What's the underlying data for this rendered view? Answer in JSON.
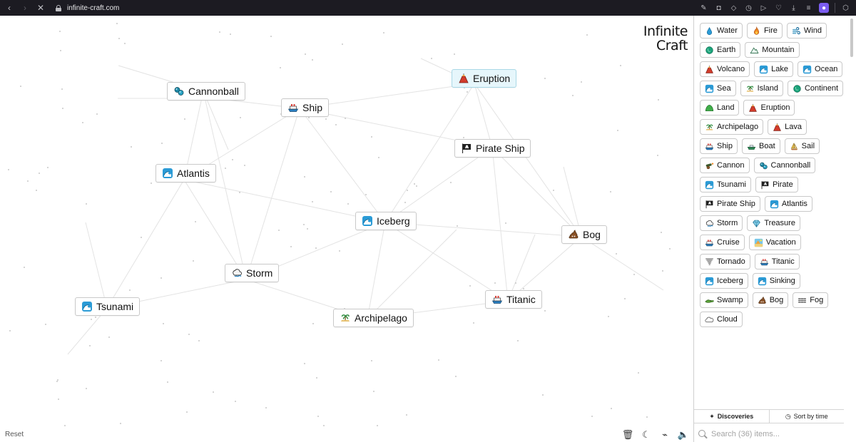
{
  "browser": {
    "url": "infinite-craft.com"
  },
  "logo": {
    "line1": "Infinite",
    "line2": "Craft"
  },
  "canvas_nodes": [
    {
      "label": "Cannonball",
      "icon": "cannonball-icon",
      "highlight": false
    },
    {
      "label": "Ship",
      "icon": "ship-icon",
      "highlight": false
    },
    {
      "label": "Eruption",
      "icon": "volcano-icon",
      "highlight": true
    },
    {
      "label": "Pirate Ship",
      "icon": "pirate-flag-icon",
      "highlight": false
    },
    {
      "label": "Atlantis",
      "icon": "wave-icon",
      "highlight": false
    },
    {
      "label": "Iceberg",
      "icon": "wave-icon",
      "highlight": false
    },
    {
      "label": "Bog",
      "icon": "poop-icon",
      "highlight": false
    },
    {
      "label": "Storm",
      "icon": "storm-cloud-icon",
      "highlight": false
    },
    {
      "label": "Tsunami",
      "icon": "wave-icon",
      "highlight": false
    },
    {
      "label": "Archipelago",
      "icon": "island-icon",
      "highlight": false
    },
    {
      "label": "Titanic",
      "icon": "ship-icon",
      "highlight": false
    }
  ],
  "sidebar": {
    "items": [
      {
        "label": "Water",
        "icon": "droplet-icon"
      },
      {
        "label": "Fire",
        "icon": "fire-icon"
      },
      {
        "label": "Wind",
        "icon": "wind-icon"
      },
      {
        "label": "Earth",
        "icon": "globe-icon"
      },
      {
        "label": "Mountain",
        "icon": "mountain-icon"
      },
      {
        "label": "Volcano",
        "icon": "volcano-icon"
      },
      {
        "label": "Lake",
        "icon": "wave-icon"
      },
      {
        "label": "Ocean",
        "icon": "wave-icon"
      },
      {
        "label": "Sea",
        "icon": "wave-icon"
      },
      {
        "label": "Island",
        "icon": "island-icon"
      },
      {
        "label": "Continent",
        "icon": "globe-icon"
      },
      {
        "label": "Land",
        "icon": "hill-icon"
      },
      {
        "label": "Eruption",
        "icon": "volcano-icon"
      },
      {
        "label": "Archipelago",
        "icon": "island-icon"
      },
      {
        "label": "Lava",
        "icon": "volcano-icon"
      },
      {
        "label": "Ship",
        "icon": "ship-icon"
      },
      {
        "label": "Boat",
        "icon": "boat-icon"
      },
      {
        "label": "Sail",
        "icon": "sailboat-icon"
      },
      {
        "label": "Cannon",
        "icon": "cannon-icon"
      },
      {
        "label": "Cannonball",
        "icon": "cannonball-icon"
      },
      {
        "label": "Tsunami",
        "icon": "wave-icon"
      },
      {
        "label": "Pirate",
        "icon": "pirate-flag-icon"
      },
      {
        "label": "Pirate Ship",
        "icon": "pirate-flag-icon"
      },
      {
        "label": "Atlantis",
        "icon": "wave-icon"
      },
      {
        "label": "Storm",
        "icon": "storm-cloud-icon"
      },
      {
        "label": "Treasure",
        "icon": "diamond-icon"
      },
      {
        "label": "Cruise",
        "icon": "ship-icon"
      },
      {
        "label": "Vacation",
        "icon": "beach-icon"
      },
      {
        "label": "Tornado",
        "icon": "tornado-icon"
      },
      {
        "label": "Titanic",
        "icon": "ship-icon"
      },
      {
        "label": "Iceberg",
        "icon": "wave-icon"
      },
      {
        "label": "Sinking",
        "icon": "wave-icon"
      },
      {
        "label": "Swamp",
        "icon": "crocodile-icon"
      },
      {
        "label": "Bog",
        "icon": "poop-icon"
      },
      {
        "label": "Fog",
        "icon": "fog-icon"
      },
      {
        "label": "Cloud",
        "icon": "cloud-icon"
      }
    ],
    "tabs": {
      "discoveries": "Discoveries",
      "sort": "Sort by time"
    },
    "search_placeholder": "Search (36) items..."
  },
  "footer": {
    "reset": "Reset"
  },
  "colors": {
    "highlight_bg": "#e6f6fb",
    "brand_purple": "#7b5cf0"
  }
}
